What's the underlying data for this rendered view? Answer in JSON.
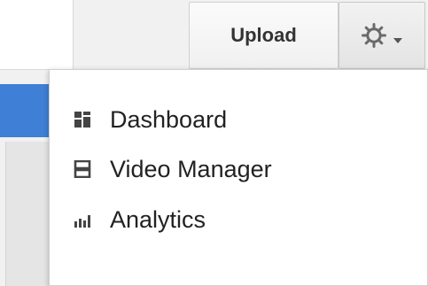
{
  "header": {
    "upload_label": "Upload",
    "settings_icon": "gear-icon",
    "settings_dropdown_icon": "chevron-down-icon"
  },
  "menu": {
    "items": [
      {
        "label": "Dashboard",
        "icon": "dashboard-icon"
      },
      {
        "label": "Video Manager",
        "icon": "video-manager-icon"
      },
      {
        "label": "Analytics",
        "icon": "analytics-icon"
      }
    ]
  },
  "colors": {
    "accent_blue": "#3f7fd5",
    "text": "#222222",
    "button_text": "#333333",
    "icon": "#444444"
  }
}
